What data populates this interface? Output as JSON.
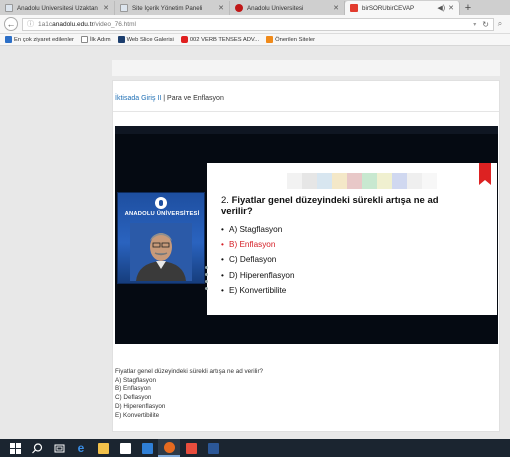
{
  "browser": {
    "tabs": [
      {
        "label": "Anadolu Üniversitesi Uzaktan ...",
        "icon": "page-icon",
        "active": false
      },
      {
        "label": "Site İçerik Yönetim Paneli",
        "icon": "page-icon",
        "active": false
      },
      {
        "label": "Anadolu Üniversitesi",
        "icon": "anadolu-logo-icon",
        "active": false
      },
      {
        "label": "birSORUbirCEVAP",
        "icon": "birsoru-icon",
        "active": true
      }
    ],
    "new_tab": "+",
    "url_prefix": "1a1c",
    "url_host": "anadolu.edu.tr",
    "url_path": "/video_76.html",
    "bookmarks": [
      {
        "label": "En çok ziyaret edilenler",
        "icon": "star-icon",
        "color": "#2c6fc7"
      },
      {
        "label": "İlk Adım",
        "icon": "page-icon",
        "color": "#ffffff"
      },
      {
        "label": "Web Slice Galerisi",
        "icon": "web-slice-icon",
        "color": "#1c3e6e"
      },
      {
        "label": "002 VERB TENSES ADV...",
        "icon": "youtube-icon",
        "color": "#e02020"
      },
      {
        "label": "Önerilen Siteler",
        "icon": "suggested-icon",
        "color": "#f08a1a"
      }
    ]
  },
  "page": {
    "breadcrumb_link": "İktisada Giriş II",
    "breadcrumb_sep": "|",
    "breadcrumb_current": "Para ve Enflasyon",
    "video": {
      "university": "ANADOLU ÜNİVERSİTESİ",
      "question_number": "2.",
      "question": "Fiyatlar genel düzeyindeki sürekli artışa ne ad verilir?",
      "options": [
        {
          "text": "A) Stagflasyon",
          "highlighted": false
        },
        {
          "text": "B) Enflasyon",
          "highlighted": true
        },
        {
          "text": "C) Deflasyon",
          "highlighted": false
        },
        {
          "text": "D) Hiperenflasyon",
          "highlighted": false
        },
        {
          "text": "E) Konvertibilite",
          "highlighted": false
        }
      ],
      "highlight_color": "#d51f26"
    },
    "transcript": [
      "Fiyatlar genel düzeyindeki sürekli artışa ne ad verilir?",
      "A) Stagflasyon",
      "B) Enflasyon",
      "C) Deflasyon",
      "D) Hiperenflasyon",
      "E) Konvertibilite"
    ]
  },
  "taskbar": {
    "items": [
      {
        "name": "windows-start-icon",
        "color": "#ffffff"
      },
      {
        "name": "search-icon",
        "color": "#ffffff"
      },
      {
        "name": "task-view-icon",
        "color": "#ffffff"
      },
      {
        "name": "edge-icon",
        "color": "#3a8ee6"
      },
      {
        "name": "file-explorer-icon",
        "color": "#f2c14a"
      },
      {
        "name": "store-icon",
        "color": "#ffffff"
      },
      {
        "name": "media-player-icon",
        "color": "#2f7fd6"
      },
      {
        "name": "firefox-icon",
        "color": "#e66a1f"
      },
      {
        "name": "paint-icon",
        "color": "#e84d3d"
      },
      {
        "name": "word-icon",
        "color": "#2b5797"
      }
    ]
  }
}
